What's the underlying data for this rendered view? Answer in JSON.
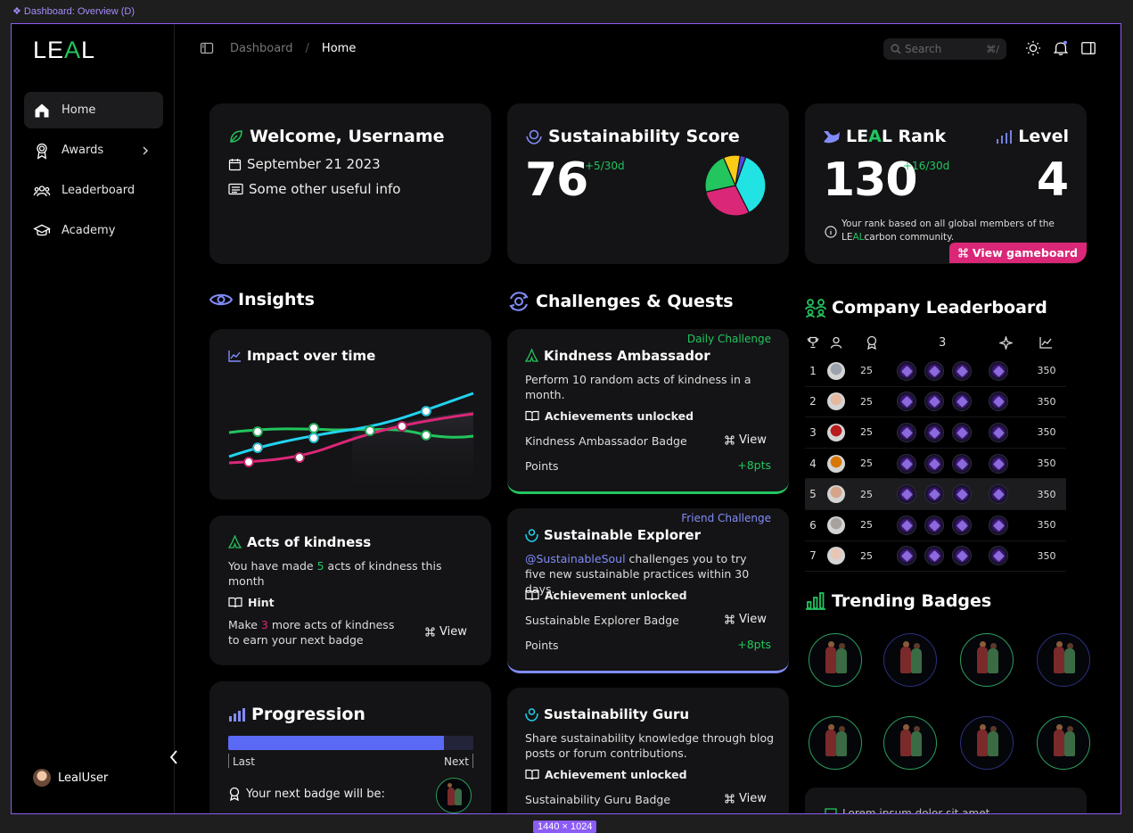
{
  "frame_label": "❖ Dashboard: Overview (D)",
  "size_tag": "1440 × 1024",
  "logo": {
    "part1": "LE",
    "part2": "A",
    "part3": "L"
  },
  "nav": [
    {
      "label": "Home",
      "icon": "home-icon"
    },
    {
      "label": "Awards",
      "icon": "award-icon"
    },
    {
      "label": "Leaderboard",
      "icon": "users-icon"
    },
    {
      "label": "Academy",
      "icon": "graduation-cap-icon"
    }
  ],
  "user": {
    "name": "LealUser"
  },
  "breadcrumb": {
    "parent": "Dashboard",
    "separator": "/",
    "current": "Home"
  },
  "search": {
    "placeholder": "Search",
    "shortcut": "⌘/"
  },
  "welcome": {
    "title": "Welcome, Username",
    "date": "September 21 2023",
    "info": "Some other useful info"
  },
  "score": {
    "title": "Sustainability Score",
    "value": "76",
    "delta": "+5/30d"
  },
  "rank": {
    "title_le": "LE",
    "title_a": "A",
    "title_l": "L",
    "title_rest": " Rank",
    "value": "130",
    "delta": "+16/30d",
    "level_title": "Level",
    "level_value": "4",
    "note_1": "Your rank based on all global members of the",
    "note_le": "LE",
    "note_al": "AL",
    "note_rest": "carbon community.",
    "button": "View gameboard"
  },
  "insights": {
    "title": "Insights",
    "impact_title": "Impact over time",
    "kindness": {
      "title": "Acts of kindness",
      "text_a": "You have made ",
      "count": "5",
      "text_b": " acts of kindness this month",
      "hint_label": "Hint",
      "hint_a": "Make ",
      "hint_count": "3",
      "hint_b": " more acts of kindness to earn your next badge",
      "view": "View"
    },
    "progression": {
      "title": "Progression",
      "last": "Last",
      "next": "Next",
      "badge_text": "Your next badge will be:",
      "progress": 0.88
    }
  },
  "challenges": {
    "title": "Challenges & Quests",
    "items": [
      {
        "tag": "Daily Challenge",
        "title": "Kindness Ambassador",
        "desc": "Perform 10 random acts of kindness in a month.",
        "unlock": "Achievements unlocked",
        "badge": "Kindness Ambassador Badge",
        "view": "View",
        "points_label": "Points",
        "points": "+8pts"
      },
      {
        "tag": "Friend Challenge",
        "title": "Sustainable Explorer",
        "mention": "@SustainableSoul",
        "desc": " challenges you to try five new sustainable practices within 30 days.",
        "unlock": "Achievement unlocked",
        "badge": "Sustainable Explorer Badge",
        "view": "View",
        "points_label": "Points",
        "points": "+8pts"
      },
      {
        "title": "Sustainability Guru",
        "desc": "Share sustainability knowledge through blog posts or forum contributions.",
        "unlock": "Achievement unlocked",
        "badge": "Sustainability Guru Badge",
        "view": "View"
      }
    ]
  },
  "leaderboard": {
    "title": "Company Leaderboard",
    "head_count": "3",
    "rows": [
      {
        "rank": "1",
        "pts": "25",
        "score": "350",
        "avatar": "#9ca3af"
      },
      {
        "rank": "2",
        "pts": "25",
        "score": "350",
        "avatar": "#e5b8a0"
      },
      {
        "rank": "3",
        "pts": "25",
        "score": "350",
        "avatar": "#b91c1c"
      },
      {
        "rank": "4",
        "pts": "25",
        "score": "350",
        "avatar": "#d97706"
      },
      {
        "rank": "5",
        "pts": "25",
        "score": "350",
        "avatar": "#d6a48a"
      },
      {
        "rank": "6",
        "pts": "25",
        "score": "350",
        "avatar": "#a8a29e"
      },
      {
        "rank": "7",
        "pts": "25",
        "score": "350",
        "avatar": "#e7c6b5"
      }
    ]
  },
  "trending": {
    "title": "Trending Badges",
    "footer": "Lorem ipsum dolor sit amet"
  },
  "colors": {
    "accent_green": "#22c55e",
    "accent_pink": "#db2777",
    "accent_blue": "#818cf8",
    "cyan": "#22d3ee"
  },
  "pie": [
    {
      "value": 0.37,
      "color": "#22e3e3"
    },
    {
      "value": 0.29,
      "color": "#db2777"
    },
    {
      "value": 0.22,
      "color": "#22c55e"
    },
    {
      "value": 0.09,
      "color": "#facc15"
    },
    {
      "value": 0.03,
      "color": "#4f46e5"
    }
  ]
}
